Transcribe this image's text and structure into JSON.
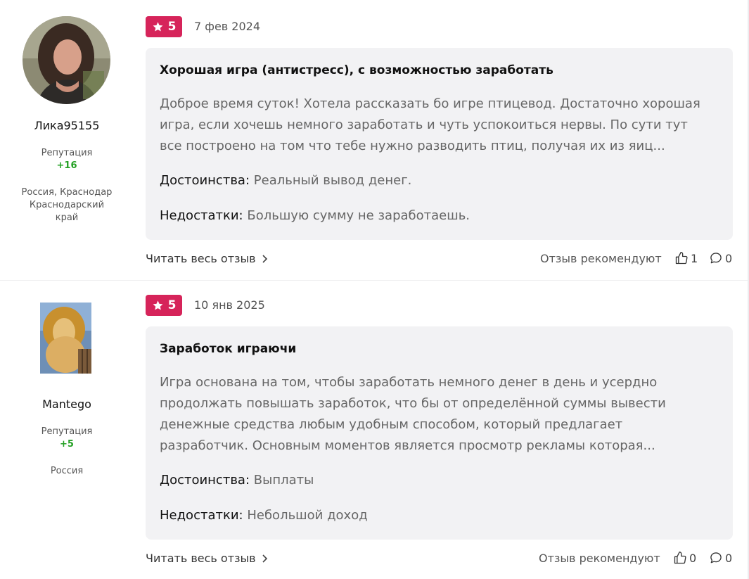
{
  "reviews": [
    {
      "author": {
        "name": "Лика95155",
        "reputation_label": "Репутация",
        "reputation": "+16",
        "location_lines": [
          "Россия, Краснодар",
          "Краснодарский",
          "край"
        ]
      },
      "rating": "5",
      "date": "7 фев 2024",
      "title": "Хорошая игра (антистресс), с возможностью заработать",
      "text_lines": [
        "Доброе время суток! Хотела рассказать бо игре птицевод. Достаточно хорошая",
        "игра, если хочешь немного заработать и чуть успокоиться нервы. По сути тут",
        "все построено на том что тебе нужно разводить птиц, получая их из яиц..."
      ],
      "pros_label": "Достоинства:",
      "pros": "Реальный вывод денег.",
      "cons_label": "Недостатки:",
      "cons": "Большую сумму не заработаешь.",
      "read_more": "Читать весь отзыв",
      "recommend_label": "Отзыв рекомендуют",
      "likes": "1",
      "comments": "0"
    },
    {
      "author": {
        "name": "Mantego",
        "reputation_label": "Репутация",
        "reputation": "+5",
        "location_lines": [
          "Россия"
        ]
      },
      "rating": "5",
      "date": "10 янв 2025",
      "title": "Заработок играючи",
      "text_lines": [
        "Игра основана на том, чтобы заработать немного денег в день и усердно",
        "продолжать повышать заработок, что бы от определённой суммы вывести",
        "денежные средства любым удобным способом, который предлагает",
        "разработчик. Основным моментов является просмотр рекламы которая..."
      ],
      "pros_label": "Достоинства:",
      "pros": "Выплаты",
      "cons_label": "Недостатки:",
      "cons": "Небольшой доход",
      "read_more": "Читать весь отзыв",
      "recommend_label": "Отзыв рекомендуют",
      "likes": "0",
      "comments": "0"
    }
  ],
  "colors": {
    "rating_badge": "#d6245a",
    "reputation_positive": "#23a023",
    "card_background": "#f2f2f4"
  },
  "icons": {
    "rating": "star-icon",
    "read_more": "chevron-right-icon",
    "likes": "thumbs-up-icon",
    "comments": "comment-bubble-icon"
  }
}
